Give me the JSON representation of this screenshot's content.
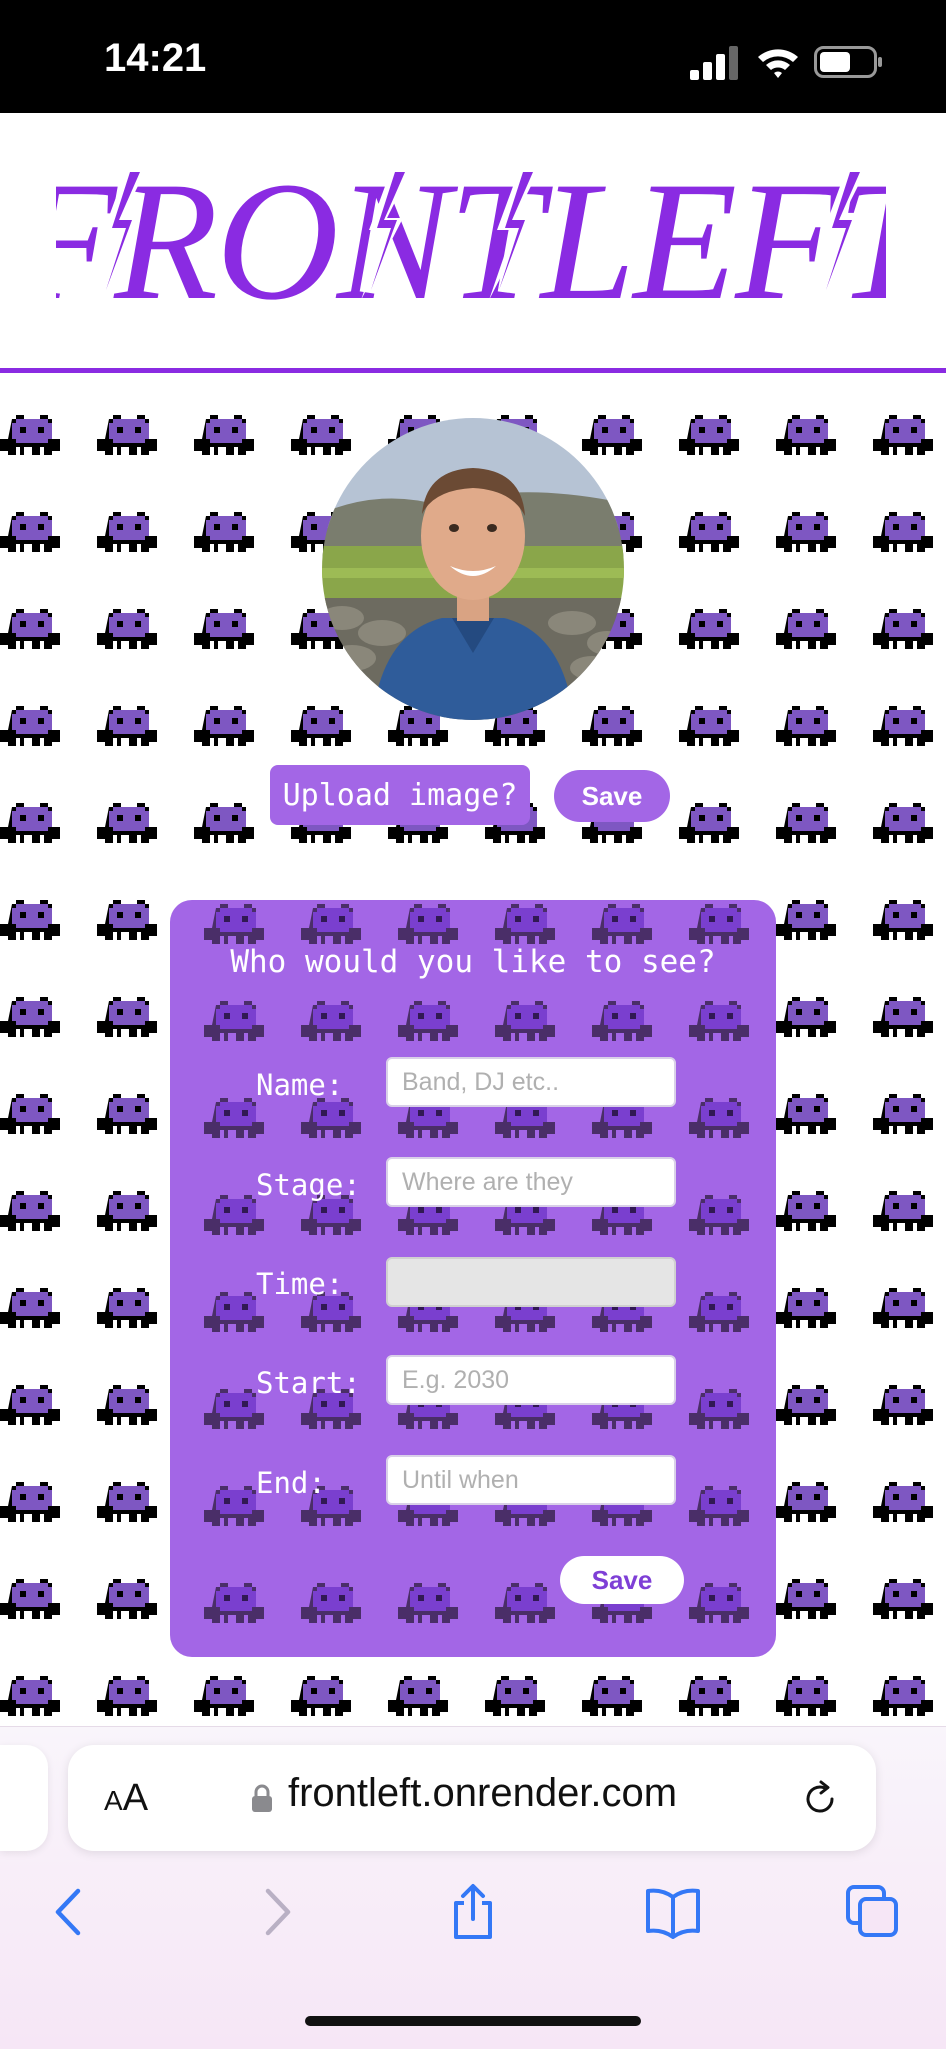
{
  "status_bar": {
    "time": "14:21"
  },
  "header": {
    "logo_text": "FRONTLEFT",
    "brand_color": "#8a2be2"
  },
  "profile": {
    "upload_label": "Upload image?",
    "save_label": "Save"
  },
  "form": {
    "title": "Who would you like to see?",
    "fields": [
      {
        "label": "Name:",
        "placeholder": "Band, DJ etc.."
      },
      {
        "label": "Stage:",
        "placeholder": "Where are they"
      },
      {
        "label": "Time:",
        "placeholder": ""
      },
      {
        "label": "Start:",
        "placeholder": "E.g. 2030"
      },
      {
        "label": "End:",
        "placeholder": "Until when"
      }
    ],
    "save_label": "Save",
    "card_color": "#a366e6"
  },
  "browser": {
    "reader_label_small": "A",
    "reader_label_large": "A",
    "url": "frontleft.onrender.com",
    "accent_color": "#3478f6"
  }
}
